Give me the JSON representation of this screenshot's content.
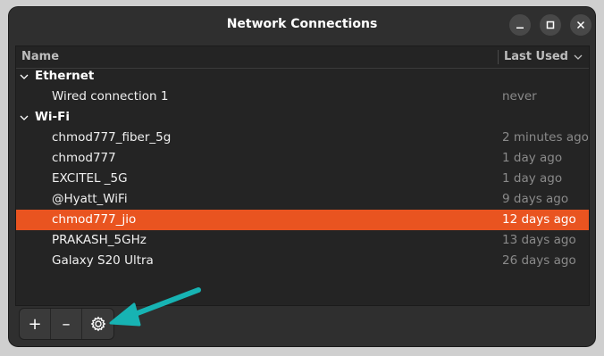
{
  "window": {
    "title": "Network Connections"
  },
  "list": {
    "columns": {
      "name": "Name",
      "last_used": "Last Used"
    },
    "rows": [
      {
        "kind": "group",
        "label": "Ethernet",
        "time": ""
      },
      {
        "kind": "item",
        "label": "Wired connection 1",
        "time": "never"
      },
      {
        "kind": "group",
        "label": "Wi-Fi",
        "time": ""
      },
      {
        "kind": "item",
        "label": "chmod777_fiber_5g",
        "time": "2 minutes ago"
      },
      {
        "kind": "item",
        "label": "chmod777",
        "time": "1 day ago"
      },
      {
        "kind": "item",
        "label": "EXCITEL _5G",
        "time": "1 day ago"
      },
      {
        "kind": "item",
        "label": "@Hyatt_WiFi",
        "time": "9 days ago"
      },
      {
        "kind": "item",
        "label": "chmod777_jio",
        "time": "12 days ago",
        "selected": true
      },
      {
        "kind": "item",
        "label": "PRAKASH_5GHz",
        "time": "13 days ago"
      },
      {
        "kind": "item",
        "label": "Galaxy S20 Ultra",
        "time": "26 days ago"
      }
    ]
  },
  "toolbar": {
    "add_label": "+",
    "remove_label": "–",
    "settings_icon": "gear-icon"
  },
  "colors": {
    "selection": "#e95420",
    "annotation_arrow": "#17b3b3"
  }
}
